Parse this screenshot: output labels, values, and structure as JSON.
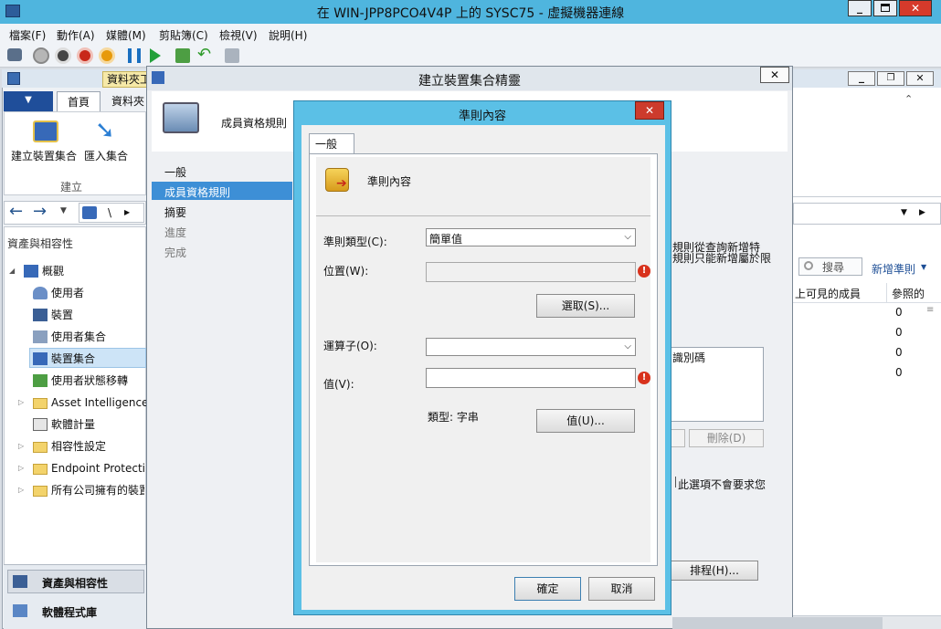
{
  "vm_window": {
    "title": "在 WIN-JPP8PCO4V4P 上的 SYSC75 - 虛擬機器連線",
    "menu": [
      "檔案(F)",
      "動作(A)",
      "媒體(M)",
      "剪貼簿(C)",
      "檢視(V)",
      "說明(H)"
    ]
  },
  "console": {
    "title_partial": "資料夾工",
    "tabs": [
      "首頁",
      "資料夾"
    ],
    "ribbon": {
      "create_collection": "建立裝置集合",
      "import_collection": "匯入集合",
      "group_label": "建立"
    },
    "path_sep": "\\",
    "nav_header": "資產與相容性",
    "tree": [
      "概觀",
      "使用者",
      "裝置",
      "使用者集合",
      "裝置集合",
      "使用者狀態移轉",
      "Asset Intelligence",
      "軟體計量",
      "相容性設定",
      "Endpoint Protection",
      "所有公司擁有的裝置"
    ],
    "wunderbar": [
      "資產與相容性",
      "軟體程式庫"
    ],
    "search_label": "搜尋",
    "add_criteria": "新增準則",
    "grid_columns": [
      "上可見的成員",
      "參照的"
    ],
    "grid_values": [
      "0",
      "0",
      "0",
      "0"
    ]
  },
  "wizard": {
    "title": "建立裝置集合精靈",
    "header": "成員資格規則",
    "steps": [
      "一般",
      "成員資格規則",
      "摘要",
      "進度",
      "完成"
    ],
    "partial_text_1": "規則從查詢新增特",
    "partial_text_2": "規則只能新增屬於限",
    "list_header": "識別碼",
    "remove_button": "刪除(D)",
    "note_text": "此選項不會要求您",
    "schedule_button": "排程(H)..."
  },
  "dialog": {
    "title": "準則內容",
    "tab": "一般",
    "heading": "準則內容",
    "criterion_type_label": "準則類型(C):",
    "criterion_type_value": "簡單值",
    "location_label": "位置(W):",
    "location_value": "",
    "select_button": "選取(S)...",
    "operator_label": "運算子(O):",
    "operator_value": "",
    "value_label": "值(V):",
    "value_value": "",
    "type_text": "類型: 字串",
    "value_button": "值(U)...",
    "ok_button": "確定",
    "cancel_button": "取消"
  },
  "colors": {
    "vm_title_bg": "#4fb5de",
    "dialog_frame": "#5bc0e6",
    "ribbon_tab": "#1f4e9a",
    "selected": "#cde4f7",
    "error_red": "#d8321c"
  }
}
